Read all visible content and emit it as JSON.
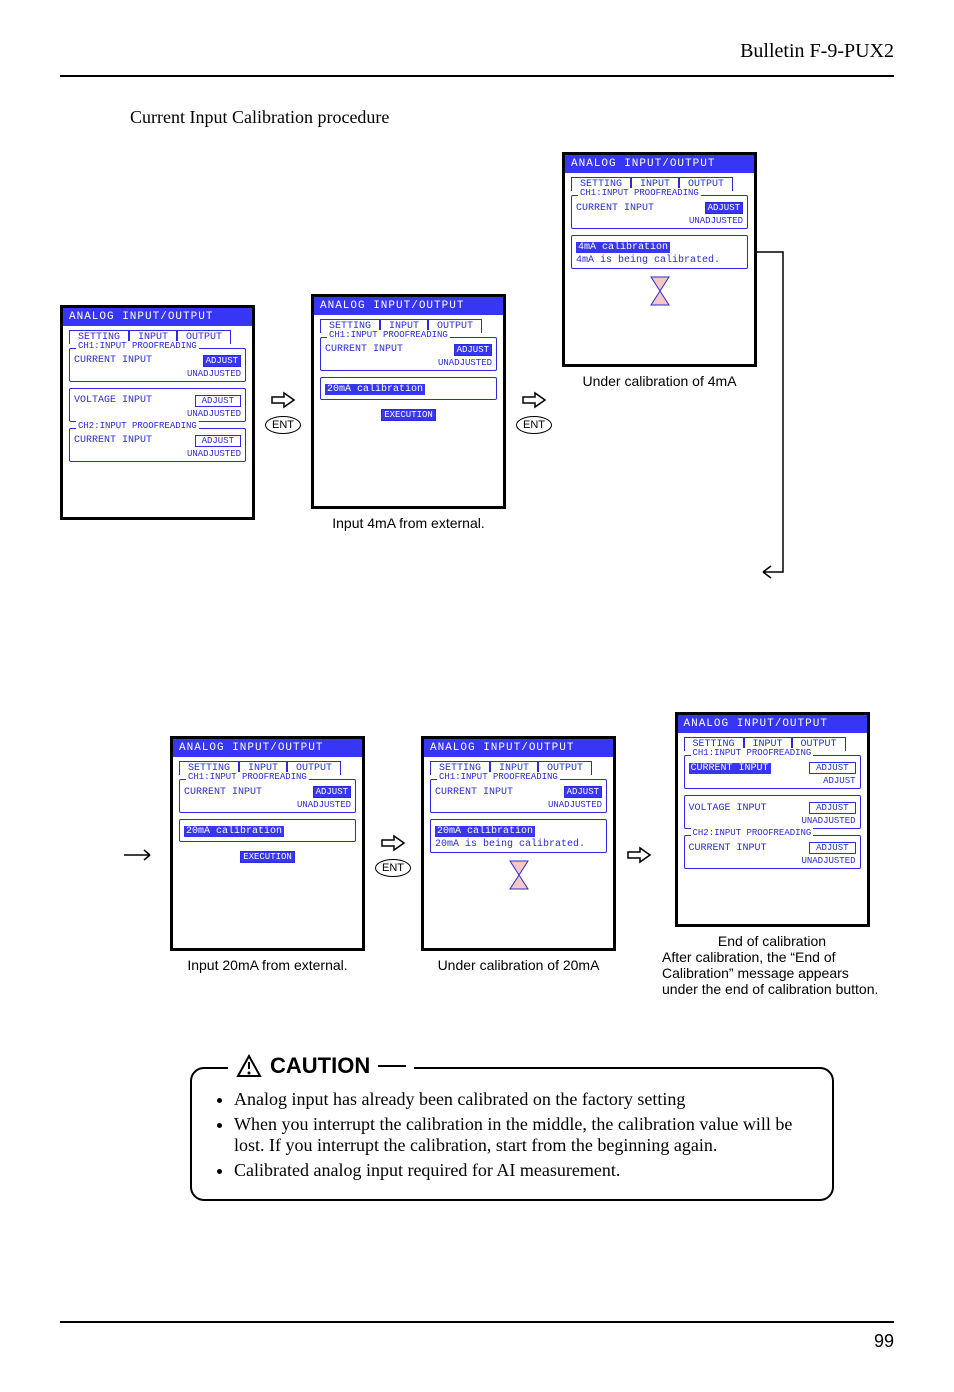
{
  "header": {
    "title": "Bulletin F-9-PUX2"
  },
  "section_title": "Current Input Calibration procedure",
  "page_number": "99",
  "ui": {
    "screen_title": "ANALOG INPUT/OUTPUT",
    "tabs": [
      "SETTING",
      "INPUT",
      "OUTPUT"
    ],
    "grp1": "CH1:INPUT PROOFREADING",
    "grp2": "CH2:INPUT PROOFREADING",
    "current_input": "CURRENT INPUT",
    "voltage_input": "VOLTAGE INPUT",
    "adjust": "ADJUST",
    "unadjusted": "UNADJUSTED",
    "cal20": "20mA calibration",
    "cal4": "4mA calibration",
    "being4": "4mA is being calibrated.",
    "being20": "20mA is being calibrated.",
    "execution": "EXECUTION",
    "ent": "ENT"
  },
  "captions": {
    "c2": "Input 4mA from external.",
    "c3": "Under calibration of 4mA",
    "c4": "Input 20mA from external.",
    "c5": "Under calibration of 20mA",
    "c6": "End of calibration",
    "after1": "After calibration, the “End of Calibration” message appears under the end of calibration button."
  },
  "caution": {
    "title": "CAUTION",
    "items": [
      "Analog input has already been calibrated on the factory setting",
      "When you interrupt the calibration in the middle, the calibration value will be lost.  If you interrupt the calibration, start from the beginning again.",
      "Calibrated analog input required for AI measurement."
    ]
  }
}
